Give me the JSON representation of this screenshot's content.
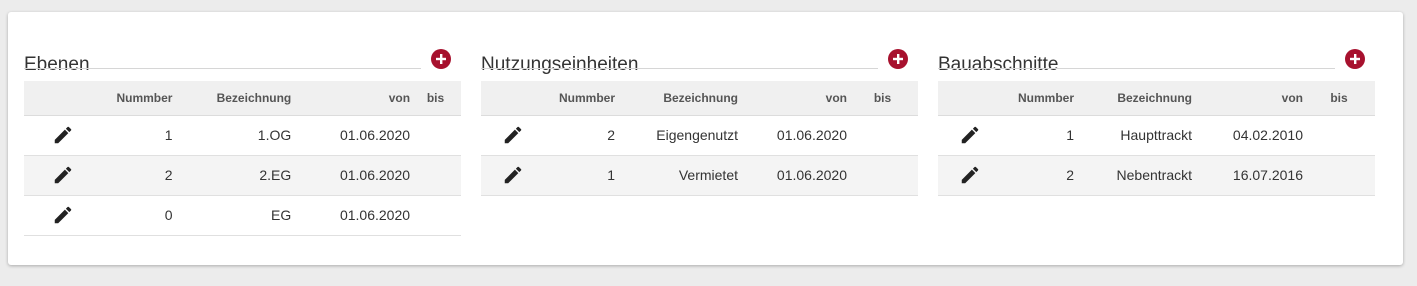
{
  "colors": {
    "accent": "#a7112e",
    "header_bg": "#f0f0f0",
    "row_alt": "#f4f4f4"
  },
  "icons": {
    "add": "plus-circle-icon",
    "edit": "pencil-icon"
  },
  "columns": {
    "nummer": "Nummber",
    "bezeichnung": "Bezeichnung",
    "von": "von",
    "bis": "bis"
  },
  "panels": [
    {
      "title": "Ebenen",
      "rows": [
        {
          "nummer": "1",
          "bezeichnung": "1.OG",
          "von": "01.06.2020",
          "bis": ""
        },
        {
          "nummer": "2",
          "bezeichnung": "2.EG",
          "von": "01.06.2020",
          "bis": ""
        },
        {
          "nummer": "0",
          "bezeichnung": "EG",
          "von": "01.06.2020",
          "bis": ""
        }
      ]
    },
    {
      "title": "Nutzungseinheiten",
      "rows": [
        {
          "nummer": "2",
          "bezeichnung": "Eigengenutzt",
          "von": "01.06.2020",
          "bis": ""
        },
        {
          "nummer": "1",
          "bezeichnung": "Vermietet",
          "von": "01.06.2020",
          "bis": ""
        }
      ]
    },
    {
      "title": "Bauabschnitte",
      "rows": [
        {
          "nummer": "1",
          "bezeichnung": "Haupttrackt",
          "von": "04.02.2010",
          "bis": ""
        },
        {
          "nummer": "2",
          "bezeichnung": "Nebentrackt",
          "von": "16.07.2016",
          "bis": ""
        }
      ]
    }
  ]
}
